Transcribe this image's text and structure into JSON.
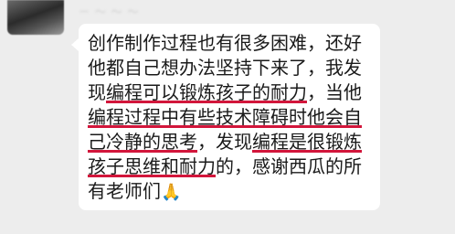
{
  "contact": {
    "name": "－ ～ ～ ～"
  },
  "message": {
    "seg1": "创作制作过程也有很多困难，还好他都自己想办法坚持下来了，我发现",
    "seg2_underlined": "编程可以锻炼孩子的耐力",
    "seg3": "，当他",
    "seg4_underlined": "编程过程中有些技术障碍时他会自己冷静的思考",
    "seg5": "，发现",
    "seg6_underlined": "编程是很锻炼孩子思维和耐力",
    "seg7": "的，感谢西瓜的所有老师们",
    "emoji": "🙏"
  },
  "colors": {
    "underline": "#d2163b",
    "bubble": "#ffffff",
    "background": "#ededed"
  },
  "icons": {
    "emoji": "folded-hands-icon"
  }
}
